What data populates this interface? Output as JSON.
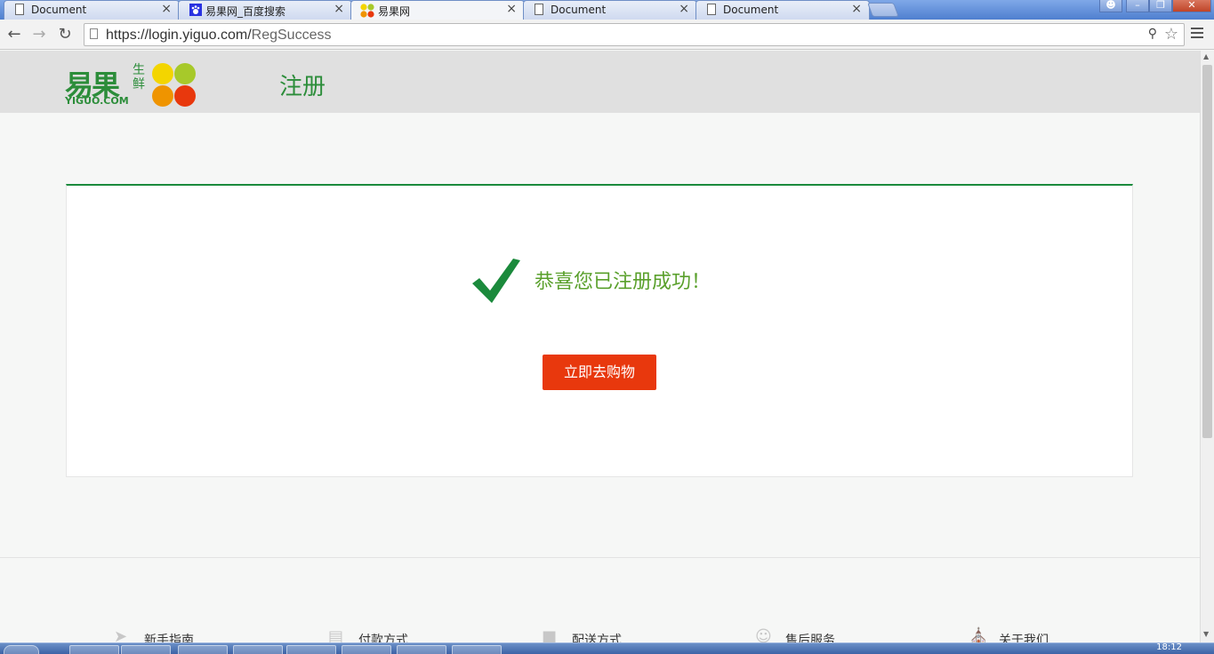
{
  "browser": {
    "tabs": [
      {
        "label": "Document",
        "icon": "document-icon",
        "active": false
      },
      {
        "label": "易果网_百度搜索",
        "icon": "baidu-paw-icon",
        "active": false
      },
      {
        "label": "易果网",
        "icon": "yiguo-favicon-icon",
        "active": true
      },
      {
        "label": "Document",
        "icon": "document-icon",
        "active": false
      },
      {
        "label": "Document",
        "icon": "document-icon",
        "active": false
      }
    ],
    "tab_close_glyph": "×",
    "url_host": "https://login.yiguo.com/",
    "url_path": "RegSuccess",
    "window_controls": {
      "minimize": "–",
      "restore": "❐",
      "close": "✕"
    }
  },
  "header": {
    "logo_cn": "易果",
    "logo_sub": "生鲜",
    "logo_en": "YIGUO.COM",
    "logo_dot_colors": [
      "#f3d500",
      "#a7c92a",
      "#ef9400",
      "#e8380d"
    ],
    "page_title": "注册"
  },
  "main": {
    "success_message": "恭喜您已注册成功！",
    "shop_button": "立即去购物",
    "accent": "#1b8a3c",
    "button_color": "#e8380d"
  },
  "footer": {
    "items": [
      {
        "label": "新手指南",
        "icon": "paper-plane-icon"
      },
      {
        "label": "付款方式",
        "icon": "card-icon"
      },
      {
        "label": "配送方式",
        "icon": "truck-icon"
      },
      {
        "label": "售后服务",
        "icon": "smiley-icon"
      },
      {
        "label": "关于我们",
        "icon": "building-icon"
      }
    ]
  },
  "taskbar": {
    "time": "18:12"
  }
}
